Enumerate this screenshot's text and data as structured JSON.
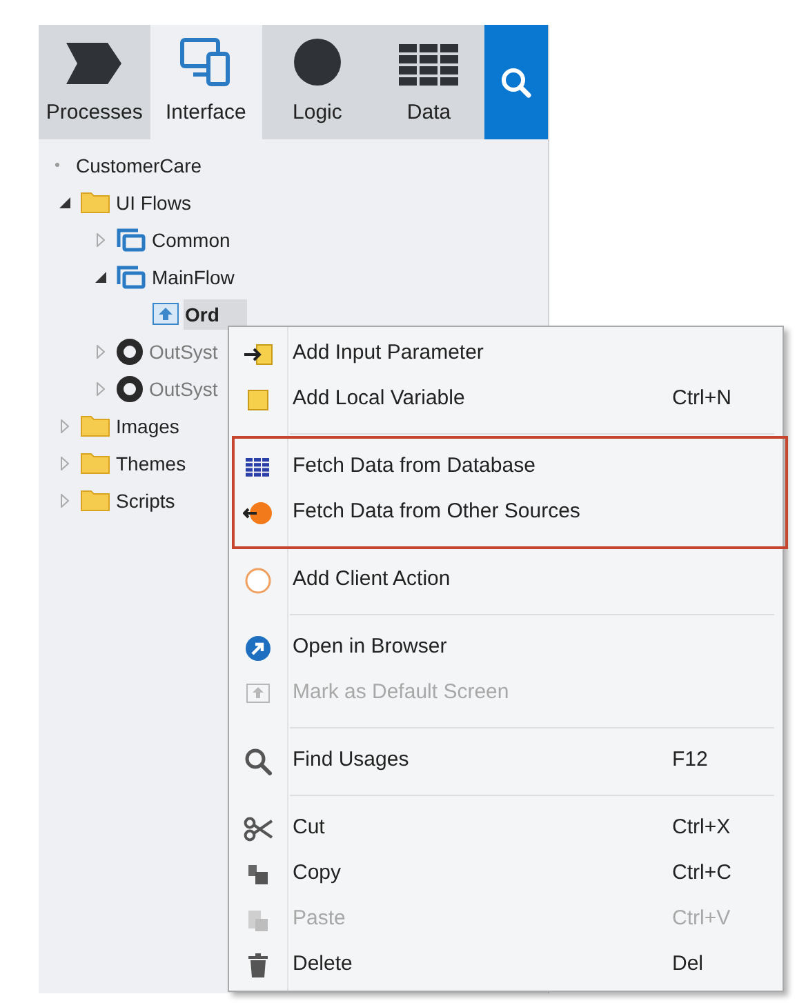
{
  "tabs": [
    {
      "label": "Processes",
      "kind": "processes",
      "selected": false
    },
    {
      "label": "Interface",
      "kind": "interface",
      "selected": true
    },
    {
      "label": "Logic",
      "kind": "logic",
      "selected": false
    },
    {
      "label": "Data",
      "kind": "data",
      "selected": false
    },
    {
      "kind": "search",
      "selected": false
    }
  ],
  "tree": [
    {
      "label": "CustomerCare",
      "kind": "root",
      "selected": false,
      "disabled": false,
      "children": [
        {
          "label": "UI Flows",
          "kind": "folder",
          "expanded": true,
          "selected": false,
          "disabled": false,
          "children": [
            {
              "label": "Common",
              "kind": "flow",
              "expanded": false,
              "selected": false,
              "disabled": false
            },
            {
              "label": "MainFlow",
              "kind": "flow",
              "expanded": true,
              "selected": false,
              "disabled": false,
              "children": [
                {
                  "label": "Ord",
                  "kind": "screen",
                  "selected": true,
                  "disabled": false
                }
              ]
            },
            {
              "label": "OutSyst",
              "kind": "module",
              "expanded": false,
              "selected": false,
              "disabled": true
            },
            {
              "label": "OutSyst",
              "kind": "module",
              "expanded": false,
              "selected": false,
              "disabled": true
            }
          ]
        },
        {
          "label": "Images",
          "kind": "folder",
          "expanded": false,
          "selected": false,
          "disabled": false
        },
        {
          "label": "Themes",
          "kind": "folder",
          "expanded": false,
          "selected": false,
          "disabled": false
        },
        {
          "label": "Scripts",
          "kind": "folder",
          "expanded": false,
          "selected": false,
          "disabled": false
        }
      ]
    }
  ],
  "context_menu": {
    "sections": [
      {
        "outlined": false,
        "items": [
          {
            "label": "Add Input Parameter",
            "disabled": false
          },
          {
            "label": "Add Local Variable",
            "shortcut": "Ctrl+N",
            "disabled": false
          }
        ]
      },
      {
        "outlined": true,
        "items": [
          {
            "label": "Fetch Data from Database",
            "disabled": false
          },
          {
            "label": "Fetch Data from Other Sources",
            "disabled": false
          }
        ]
      },
      {
        "outlined": false,
        "items": [
          {
            "label": "Add Client Action",
            "disabled": false
          }
        ]
      },
      {
        "outlined": false,
        "items": [
          {
            "label": "Open in Browser",
            "disabled": false
          },
          {
            "label": "Mark as Default Screen",
            "disabled": true
          }
        ]
      },
      {
        "outlined": false,
        "items": [
          {
            "label": "Find Usages",
            "shortcut": "F12",
            "disabled": false
          }
        ]
      },
      {
        "outlined": false,
        "items": [
          {
            "label": "Cut",
            "shortcut": "Ctrl+X",
            "disabled": false
          },
          {
            "label": "Copy",
            "shortcut": "Ctrl+C",
            "disabled": false
          },
          {
            "label": "Paste",
            "shortcut": "Ctrl+V",
            "disabled": true
          },
          {
            "label": "Delete",
            "shortcut": "Del",
            "disabled": false
          }
        ]
      }
    ]
  }
}
